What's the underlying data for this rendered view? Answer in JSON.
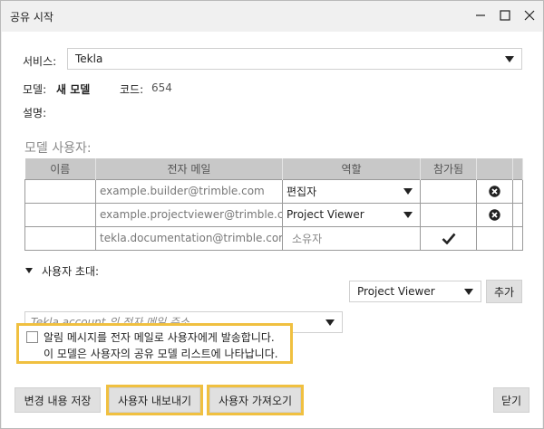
{
  "window": {
    "title": "공유 시작"
  },
  "service": {
    "label": "서비스:",
    "value": "Tekla"
  },
  "model": {
    "label": "모델:",
    "name": "새 모델",
    "code_label": "코드:",
    "code": "654"
  },
  "description": {
    "label": "설명:"
  },
  "users_section": {
    "title": "모델 사용자:",
    "columns": [
      "이름",
      "전자 메일",
      "역할",
      "참가됨"
    ],
    "rows": [
      {
        "name": "",
        "email": "example.builder@trimble.com",
        "role": "편집자",
        "joined": false,
        "removable": true
      },
      {
        "name": "",
        "email": "example.projectviewer@trimble.com",
        "role": "Project Viewer",
        "joined": false,
        "removable": true
      },
      {
        "name": "",
        "email": "tekla.documentation@trimble.com",
        "role": "소유자",
        "joined": true,
        "removable": false
      }
    ]
  },
  "invite": {
    "label": "사용자 초대:",
    "email_placeholder": "Tekla account 의 전자 메일 주소",
    "role": "Project Viewer",
    "add_label": "추가"
  },
  "notify": {
    "line1": "알림 메시지를 전자 메일로 사용자에게 발송합니다.",
    "line2": "이 모델은 사용자의 공유 모델 리스트에 나타납니다.",
    "checked": false
  },
  "footer": {
    "save_label": "변경 내용 저장",
    "export_label": "사용자 내보내기",
    "import_label": "사용자 가져오기",
    "close_label": "닫기"
  },
  "colors": {
    "highlight": "#f0c040",
    "header_bg": "#c8c8c8"
  }
}
